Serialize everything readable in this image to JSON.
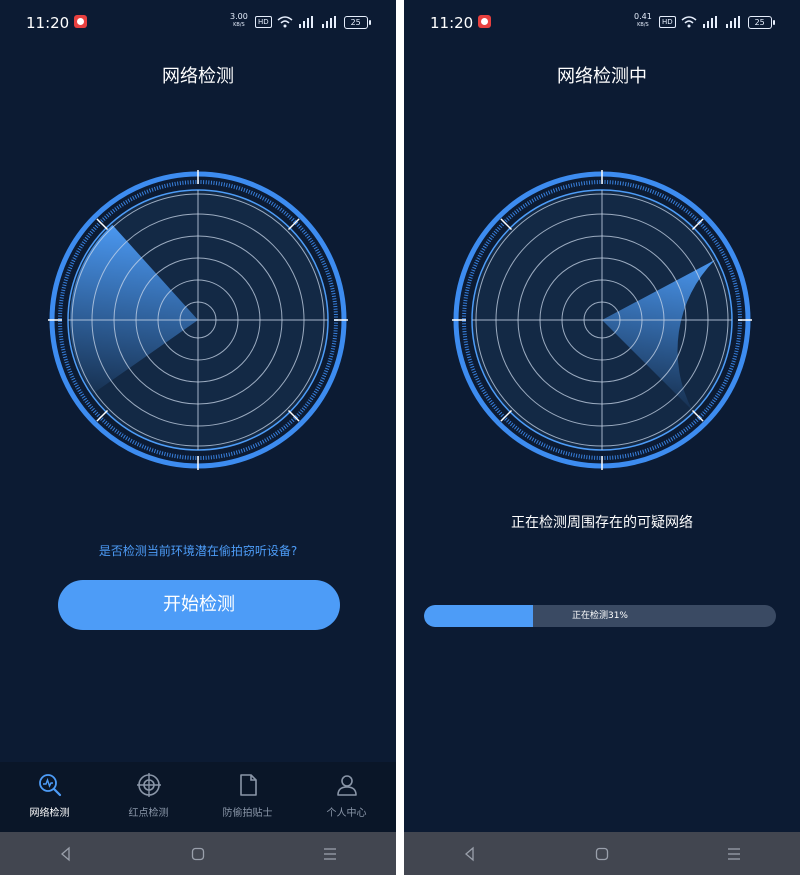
{
  "status_bar": {
    "time": "11:20",
    "left_speed_value": "3.00",
    "right_speed_value": "0.41",
    "speed_unit": "KB/S",
    "hd_label": "HD",
    "battery": "25"
  },
  "screen1": {
    "title": "网络检测",
    "question": "是否检测当前环境潜在偷拍窃听设备?",
    "start_button": "开始检测"
  },
  "screen2": {
    "title": "网络检测中",
    "scan_text": "正在检测周围存在的可疑网络",
    "progress_percent": 31,
    "progress_label": "正在检测31%"
  },
  "tabs": [
    {
      "label": "网络检测",
      "icon": "network-scan-icon",
      "active": true
    },
    {
      "label": "红点检测",
      "icon": "crosshair-icon",
      "active": false
    },
    {
      "label": "防偷拍贴士",
      "icon": "document-icon",
      "active": false
    },
    {
      "label": "个人中心",
      "icon": "person-icon",
      "active": false
    }
  ],
  "colors": {
    "background": "#0c1b33",
    "accent": "#4d9cf7",
    "tabbar": "#0a1628",
    "navbar": "#424650",
    "progress_track": "#3a4a63"
  }
}
